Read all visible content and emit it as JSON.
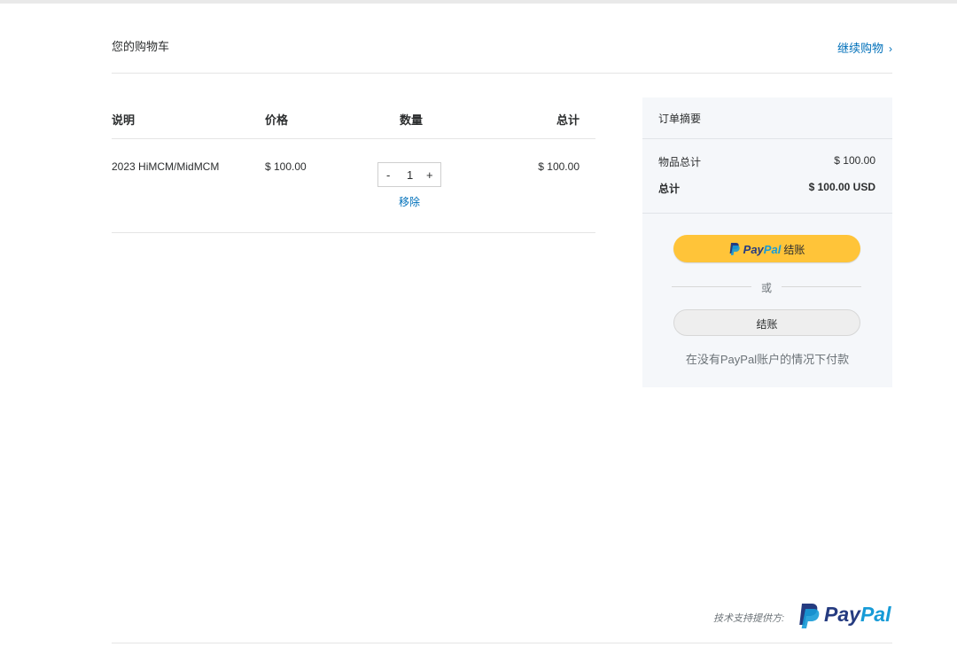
{
  "header": {
    "title": "您的购物车",
    "continue_label": "继续购物",
    "continue_icon": "chevron-right-icon",
    "continue_glyph": "›"
  },
  "cart": {
    "columns": {
      "description": "说明",
      "price": "价格",
      "quantity": "数量",
      "total": "总计"
    },
    "items": [
      {
        "description": "2023 HiMCM/MidMCM",
        "price": "$ 100.00",
        "quantity": "1",
        "total": "$ 100.00",
        "remove_label": "移除"
      }
    ],
    "stepper": {
      "minus": "-",
      "plus": "+"
    }
  },
  "summary": {
    "title": "订单摘要",
    "items_total_label": "物品总计",
    "items_total_value": "$ 100.00",
    "total_label": "总计",
    "total_value": "$ 100.00 USD",
    "paypal_button": {
      "word1": "Pay",
      "word2": "Pal",
      "suffix": "结账",
      "color": "#ffc439"
    },
    "or_text": "或",
    "checkout_label": "结账",
    "no_account_text": "在没有PayPal账户的情况下付款"
  },
  "footer": {
    "powered_by": "技术支持提供方:",
    "logo_word1": "Pay",
    "logo_word2": "Pal"
  },
  "colors": {
    "link": "#0070ba",
    "paypal_dark": "#253b80",
    "paypal_light": "#179bd7",
    "summary_bg": "#f5f7fa"
  }
}
